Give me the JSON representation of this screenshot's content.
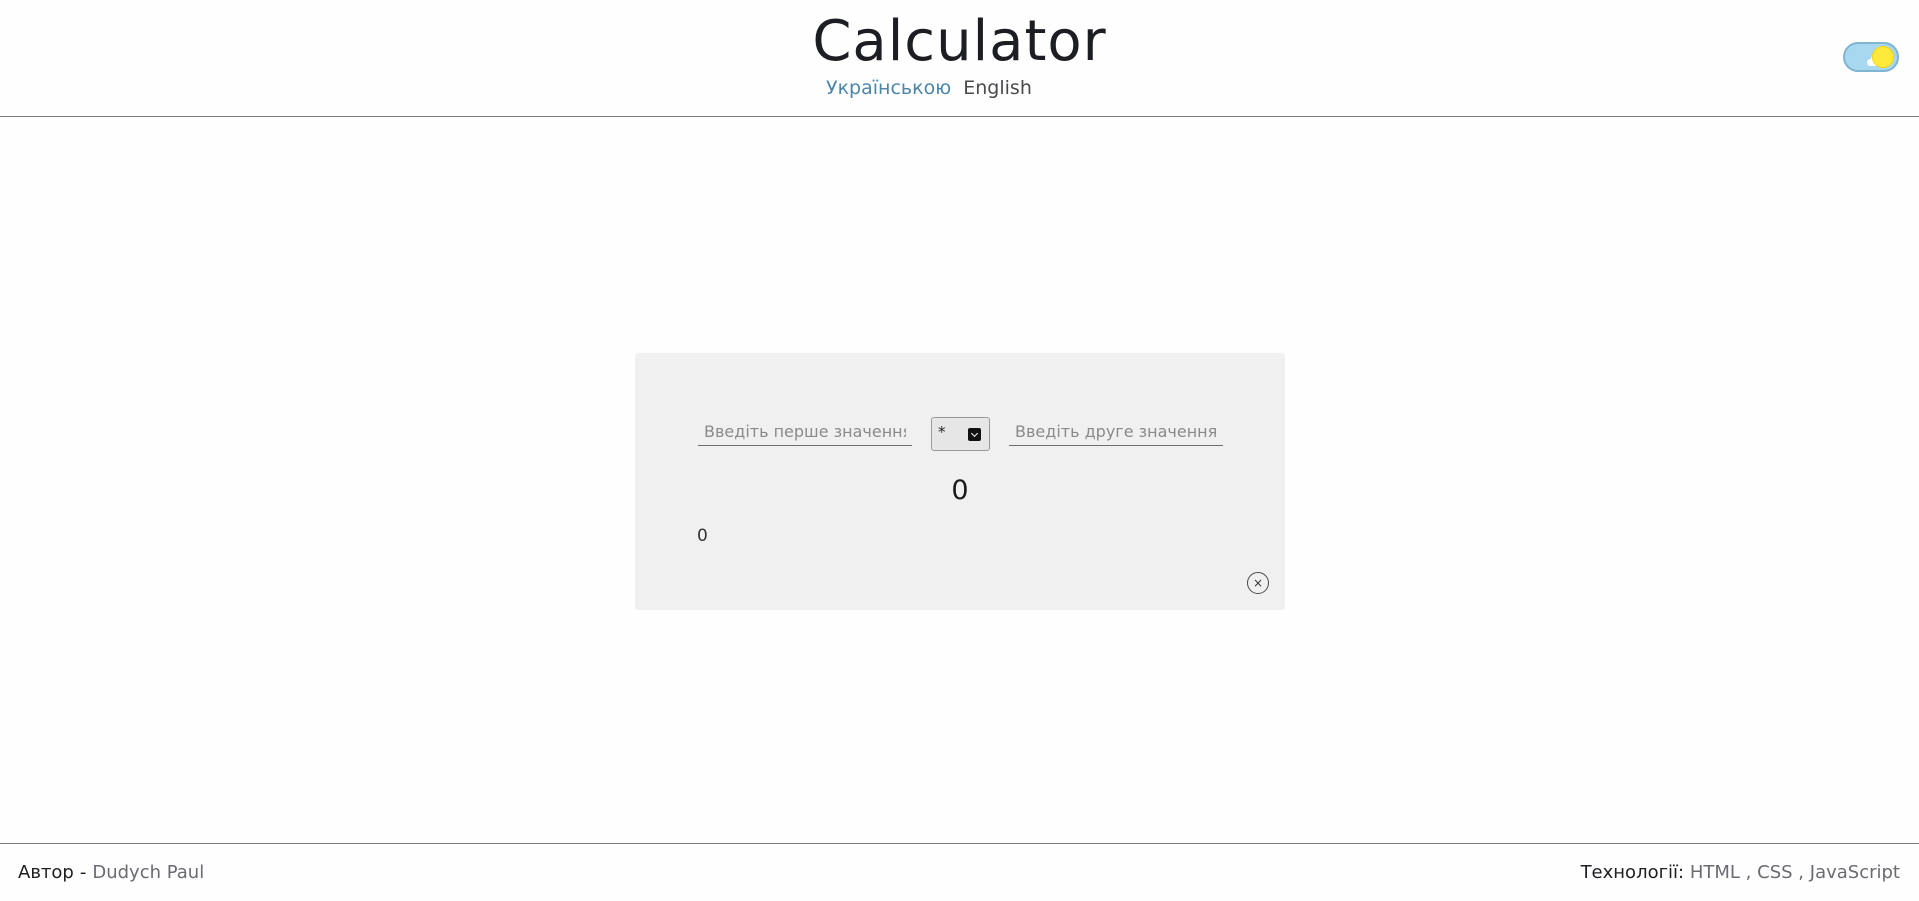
{
  "header": {
    "title": "Calculator",
    "languages": {
      "ukrainian": "Українською",
      "english": "English"
    },
    "theme_toggle": {
      "state": "light",
      "icons": [
        "sun-icon",
        "cloud-icon"
      ]
    }
  },
  "calculator": {
    "first_input": {
      "value": "",
      "placeholder": "Введіть перше значення"
    },
    "operator": {
      "selected": "*"
    },
    "second_input": {
      "value": "",
      "placeholder": "Введіть друге значення"
    },
    "result": "0",
    "history": "0",
    "clear_icon": "×"
  },
  "footer": {
    "author_label": "Автор",
    "author_separator": "-",
    "author_name": "Dudych Paul",
    "tech_label": "Технології:",
    "tech_items": [
      "HTML",
      "CSS",
      "JavaScript"
    ],
    "tech_separator": ","
  },
  "colors": {
    "accent_link": "#4b86a9",
    "card_background": "#f0f0f0",
    "toggle_background": "#a8d8ef",
    "sun": "#ffe93a"
  }
}
